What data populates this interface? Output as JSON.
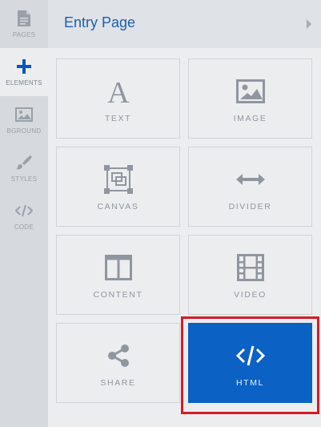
{
  "rail": {
    "items": [
      {
        "label": "PAGES",
        "icon": "page-icon"
      },
      {
        "label": "ELEMENTS",
        "icon": "plus-icon"
      },
      {
        "label": "BGROUND",
        "icon": "image-icon"
      },
      {
        "label": "STYLES",
        "icon": "brush-icon"
      },
      {
        "label": "CODE",
        "icon": "code-icon"
      }
    ],
    "active": "ELEMENTS"
  },
  "header": {
    "title": "Entry Page"
  },
  "tiles": [
    {
      "label": "TEXT",
      "icon": "text-a-icon"
    },
    {
      "label": "IMAGE",
      "icon": "image-icon"
    },
    {
      "label": "CANVAS",
      "icon": "canvas-icon"
    },
    {
      "label": "DIVIDER",
      "icon": "divider-arrow-icon"
    },
    {
      "label": "CONTENT",
      "icon": "content-columns-icon"
    },
    {
      "label": "VIDEO",
      "icon": "film-icon"
    },
    {
      "label": "SHARE",
      "icon": "share-icon"
    },
    {
      "label": "HTML",
      "icon": "code-icon",
      "selected": true
    }
  ],
  "colors": {
    "accent": "#0b61c4",
    "highlight": "#d41c28",
    "icon": "#9aa0a8",
    "title": "#1d5fb1"
  }
}
